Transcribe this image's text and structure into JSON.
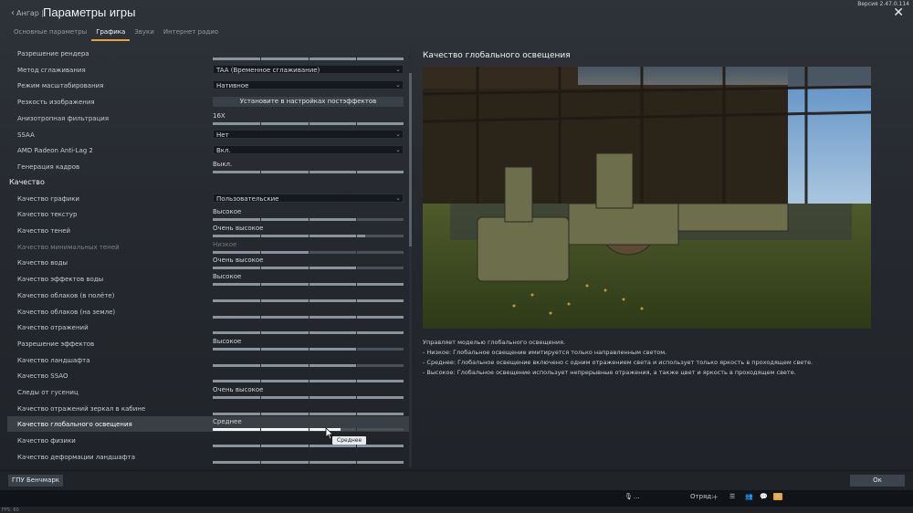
{
  "header": {
    "back_label": "Ангар",
    "title": "Параметры игры",
    "version": "Версия 2.47.0.114"
  },
  "tabs": [
    {
      "label": "Основные параметры",
      "active": false
    },
    {
      "label": "Графика",
      "active": true
    },
    {
      "label": "Звуки",
      "active": false
    },
    {
      "label": "Интернет радио",
      "active": false
    }
  ],
  "settings_top": [
    {
      "label": "Разрешение рендера",
      "kind": "slider",
      "value": "",
      "fill": 1.0
    },
    {
      "label": "Метод сглаживания",
      "kind": "dropdown",
      "value": "TAA (Временное сглаживание)"
    },
    {
      "label": "Режим масштабирования",
      "kind": "dropdown",
      "value": "Нативное"
    },
    {
      "label": "Резкость изображения",
      "kind": "button",
      "value": "Установите в настройках постэффектов"
    },
    {
      "label": "Анизотропная фильтрация",
      "kind": "slider",
      "value": "16X",
      "fill": 1.0
    },
    {
      "label": "SSAA",
      "kind": "dropdown",
      "value": "Нет"
    },
    {
      "label": "AMD Radeon Anti-Lag 2",
      "kind": "dropdown",
      "value": "Вкл."
    },
    {
      "label": "Генерация кадров",
      "kind": "slider",
      "value": "Выкл.",
      "fill": 1.0
    }
  ],
  "section_quality": "Качество",
  "settings_quality": [
    {
      "label": "Качество графики",
      "kind": "dropdown",
      "value": "Пользовательские"
    },
    {
      "label": "Качество текстур",
      "kind": "slider",
      "value": "Высокое",
      "fill": 0.75
    },
    {
      "label": "Качество теней",
      "kind": "slider",
      "value": "Очень высокое",
      "fill": 0.8
    },
    {
      "label": "Качество минимальных теней",
      "kind": "slider",
      "value": "Низкое",
      "fill": 0.5,
      "dim": true
    },
    {
      "label": "Качество воды",
      "kind": "slider",
      "value": "Очень высокое",
      "fill": 0.75
    },
    {
      "label": "Качество эффектов воды",
      "kind": "slider",
      "value": "Высокое",
      "fill": 1.0
    },
    {
      "label": "Качество облаков (в полёте)",
      "kind": "slider",
      "value": "",
      "fill": 1.0
    },
    {
      "label": "Качество облаков (на земле)",
      "kind": "slider",
      "value": "",
      "fill": 1.0
    },
    {
      "label": "Качество отражений",
      "kind": "slider",
      "value": "",
      "fill": 1.0
    },
    {
      "label": "Разрешение эффектов",
      "kind": "slider",
      "value": "Высокое",
      "fill": 0.75
    },
    {
      "label": "Качество ландшафта",
      "kind": "slider",
      "value": "",
      "fill": 0.75
    },
    {
      "label": "Качество SSAO",
      "kind": "slider",
      "value": "",
      "fill": 1.0
    },
    {
      "label": "Следы от гусениц",
      "kind": "slider",
      "value": "Очень высокое",
      "fill": 1.0
    },
    {
      "label": "Качество отражений зеркал в кабине",
      "kind": "slider",
      "value": "",
      "fill": 1.0
    },
    {
      "label": "Качество глобального освещения",
      "kind": "slider",
      "value": "Среднее",
      "fill": 0.67,
      "selected": true
    },
    {
      "label": "Качество физики",
      "kind": "slider",
      "value": "",
      "fill": 1.0
    },
    {
      "label": "Качество деформации ландшафта",
      "kind": "slider",
      "value": "",
      "fill": 1.0
    }
  ],
  "tooltip": "Среднее",
  "preview": {
    "title": "Качество глобального освещения"
  },
  "description": [
    "Управляет моделью глобального освещения.",
    "- Низкое: Глобальное освещение имитируется только направленным светом.",
    "- Среднее: Глобальное освещение включено с одним отражением света и использует только яркость в проходящем свете.",
    "- Высокое: Глобальное освещение использует непрерывные отражения, а также цвет и яркость в проходящем свете."
  ],
  "footer": {
    "benchmark_label": "ГПУ Бенчмарк",
    "ok_label": "Ок",
    "voice_label": "...",
    "squad_label": "Отряд:"
  },
  "fps_text": "FPS: 60",
  "colors": {
    "accent": "#e6a33a",
    "background": "#23272d"
  },
  "icons": [
    "back-chevron-icon",
    "close-icon",
    "microphone-icon",
    "plus-icon",
    "list-icon",
    "users-icon",
    "chat-icon",
    "mail-icon"
  ]
}
